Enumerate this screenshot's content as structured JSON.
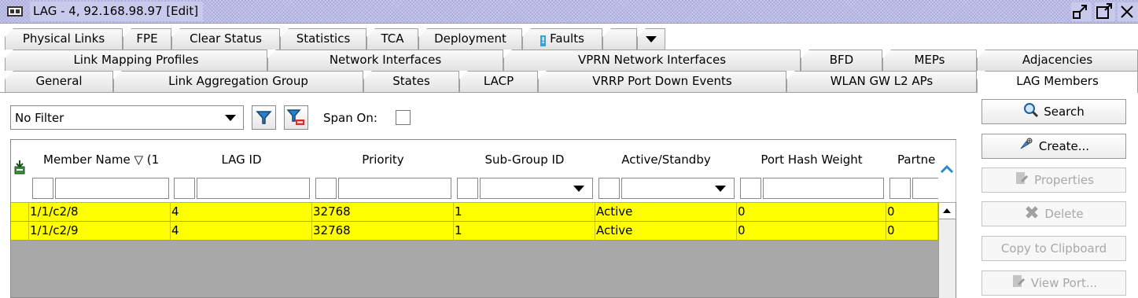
{
  "window": {
    "title": "LAG - 4, 92.168.98.97 [Edit]"
  },
  "tabs": {
    "row1": [
      "Physical Links",
      "FPE",
      "Clear Status",
      "Statistics",
      "TCA",
      "Deployment",
      "Faults",
      ""
    ],
    "row2": [
      "Link Mapping Profiles",
      "Network Interfaces",
      "VPRN Network Interfaces",
      "BFD",
      "MEPs",
      "Adjacencies"
    ],
    "row3": [
      "General",
      "Link Aggregation Group",
      "States",
      "LACP",
      "VRRP Port Down Events",
      "WLAN GW L2 APs",
      "LAG Members"
    ],
    "selected": "LAG Members"
  },
  "filter": {
    "selected": "No Filter",
    "span_label": "Span On:",
    "span_checked": false
  },
  "table": {
    "columns": [
      "Member Name ▽ (1",
      "LAG ID",
      "Priority",
      "Sub-Group ID",
      "Active/Standby",
      "Port Hash Weight",
      "Partne"
    ],
    "rows": [
      [
        "1/1/c2/8",
        "4",
        "32768",
        "1",
        "Active",
        "0",
        "0"
      ],
      [
        "1/1/c2/9",
        "4",
        "32768",
        "1",
        "Active",
        "0",
        "0"
      ]
    ]
  },
  "buttons": {
    "search": "Search",
    "create": "Create...",
    "properties": "Properties",
    "delete": "Delete",
    "copy": "Copy to Clipboard",
    "view_port": "View Port..."
  },
  "colors": {
    "row_highlight": "#ffff00",
    "titlebar": "#c9c9ec",
    "table_background": "#a8a8a8"
  },
  "icons": [
    "window-icon",
    "restore-icon",
    "maximize-icon",
    "faults-icon",
    "dropdown-arrow-icon",
    "filter-icon",
    "clear-filter-icon",
    "export-icon",
    "search-icon",
    "create-icon",
    "properties-icon",
    "delete-icon",
    "view-port-icon",
    "scroll-up-icon"
  ]
}
